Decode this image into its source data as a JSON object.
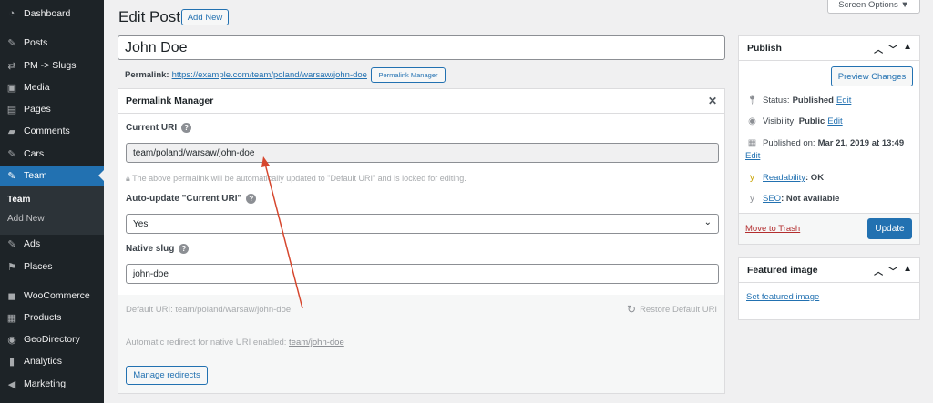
{
  "sidebar": {
    "items": [
      {
        "label": "Dashboard",
        "icon": "dashboard-icon"
      },
      {
        "label": "Posts",
        "icon": "pin-icon"
      },
      {
        "label": "PM -> Slugs",
        "icon": "shuffle-icon"
      },
      {
        "label": "Media",
        "icon": "media-icon"
      },
      {
        "label": "Pages",
        "icon": "page-icon"
      },
      {
        "label": "Comments",
        "icon": "comment-icon"
      },
      {
        "label": "Cars",
        "icon": "pin-icon"
      },
      {
        "label": "Team",
        "icon": "pin-icon"
      },
      {
        "label": "Ads",
        "icon": "pin-icon"
      },
      {
        "label": "Places",
        "icon": "places-icon"
      },
      {
        "label": "WooCommerce",
        "icon": "woo-icon"
      },
      {
        "label": "Products",
        "icon": "products-icon"
      },
      {
        "label": "GeoDirectory",
        "icon": "globe-icon"
      },
      {
        "label": "Analytics",
        "icon": "analytics-icon"
      },
      {
        "label": "Marketing",
        "icon": "megaphone-icon"
      }
    ],
    "submenu": {
      "current": "Team",
      "add_new": "Add New"
    }
  },
  "header": {
    "title": "Edit Post",
    "add_new": "Add New",
    "screen_options": "Screen Options ▼"
  },
  "post": {
    "title": "John Doe",
    "permalink_label": "Permalink:",
    "permalink_url": "https://example.com/team/poland/warsaw/john-doe",
    "permalink_manager_btn": "Permalink Manager"
  },
  "pm": {
    "heading": "Permalink Manager",
    "close": "✕",
    "current_uri_label": "Current URI",
    "current_uri_value": "team/poland/warsaw/john-doe",
    "lock_note": "The above permalink will be automatically updated to \"Default URI\" and is locked for editing.",
    "auto_update_label": "Auto-update \"Current URI\"",
    "auto_update_value": "Yes",
    "native_slug_label": "Native slug",
    "native_slug_value": "john-doe",
    "default_uri_label": "Default URI:",
    "default_uri_value": "team/poland/warsaw/john-doe",
    "restore_label": "Restore Default URI",
    "redirect_label": "Automatic redirect for native URI enabled:",
    "redirect_value": "team/john-doe",
    "manage_redirects": "Manage redirects"
  },
  "publish": {
    "heading": "Publish",
    "preview": "Preview Changes",
    "status_label": "Status:",
    "status_value": "Published",
    "visibility_label": "Visibility:",
    "visibility_value": "Public",
    "published_label": "Published on:",
    "published_value": "Mar 21, 2019 at 13:49",
    "edit": "Edit",
    "readability_label": "Readability",
    "readability_value": ": OK",
    "seo_label": "SEO",
    "seo_value": ": Not available",
    "trash": "Move to Trash",
    "update": "Update"
  },
  "featured": {
    "heading": "Featured image",
    "set_link": "Set featured image"
  },
  "colors": {
    "accent": "#2271b1",
    "sidebar_bg": "#1d2327",
    "arrow": "#d6462d"
  }
}
